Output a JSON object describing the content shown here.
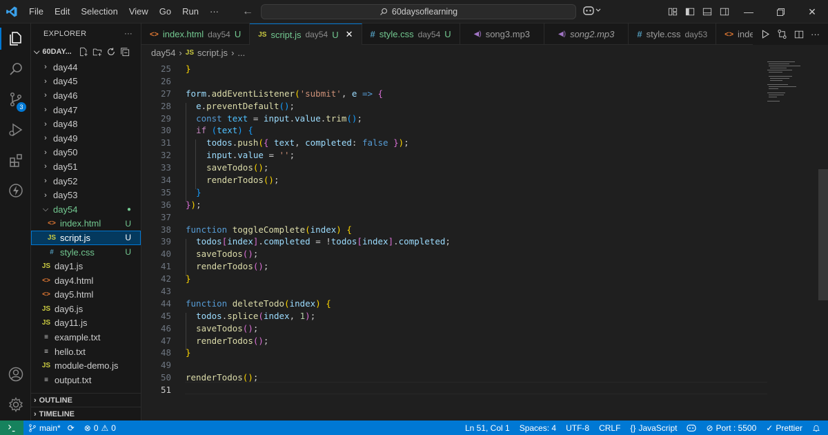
{
  "titlebar": {
    "menu": [
      "File",
      "Edit",
      "Selection",
      "View",
      "Go",
      "Run",
      "···"
    ],
    "search_text": "60daysoflearning"
  },
  "activity": {
    "scm_badge": "3"
  },
  "sidebar": {
    "title": "EXPLORER",
    "more": "···",
    "workspace": "60DAY...",
    "folders": [
      "day44",
      "day45",
      "day46",
      "day47",
      "day48",
      "day49",
      "day50",
      "day51",
      "day52",
      "day53"
    ],
    "open_folder": "day54",
    "open_folder_children": [
      {
        "name": "index.html",
        "icon": "<>",
        "status": "U"
      },
      {
        "name": "script.js",
        "icon": "JS",
        "status": "U"
      },
      {
        "name": "style.css",
        "icon": "#",
        "status": "U"
      }
    ],
    "files": [
      {
        "name": "day1.js",
        "icon": "JS"
      },
      {
        "name": "day4.html",
        "icon": "<>"
      },
      {
        "name": "day5.html",
        "icon": "<>"
      },
      {
        "name": "day6.js",
        "icon": "JS"
      },
      {
        "name": "day11.js",
        "icon": "JS"
      },
      {
        "name": "example.txt",
        "icon": "≡"
      },
      {
        "name": "hello.txt",
        "icon": "≡"
      },
      {
        "name": "module-demo.js",
        "icon": "JS"
      },
      {
        "name": "output.txt",
        "icon": "≡"
      }
    ],
    "outline": "OUTLINE",
    "timeline": "TIMELINE"
  },
  "tabs": [
    {
      "icon": "<>",
      "name": "index.html",
      "desc": "day54",
      "status": "U"
    },
    {
      "icon": "JS",
      "name": "script.js",
      "desc": "day54",
      "status": "U",
      "close": "✕"
    },
    {
      "icon": "#",
      "name": "style.css",
      "desc": "day54",
      "status": "U"
    },
    {
      "icon": "◀)",
      "name": "song3.mp3",
      "desc": ""
    },
    {
      "icon": "◀)",
      "name": "song2.mp3",
      "desc": ""
    },
    {
      "icon": "#",
      "name": "style.css",
      "desc": "day53"
    },
    {
      "icon": "<>",
      "name": "index.h",
      "desc": ""
    }
  ],
  "breadcrumb": {
    "folder": "day54",
    "file": "script.js",
    "more": "..."
  },
  "editor": {
    "line_numbers": [
      "25",
      "26",
      "27",
      "28",
      "29",
      "30",
      "31",
      "32",
      "33",
      "34",
      "35",
      "36",
      "37",
      "38",
      "39",
      "40",
      "41",
      "42",
      "43",
      "44",
      "45",
      "46",
      "47",
      "48",
      "49",
      "50",
      "51"
    ],
    "current_line": "51"
  },
  "status": {
    "branch": "main*",
    "errors": "0",
    "warnings": "0",
    "position": "Ln 51, Col 1",
    "spaces": "Spaces: 4",
    "encoding": "UTF-8",
    "eol": "CRLF",
    "language": "JavaScript",
    "port": "Port : 5500",
    "prettier": "Prettier"
  }
}
